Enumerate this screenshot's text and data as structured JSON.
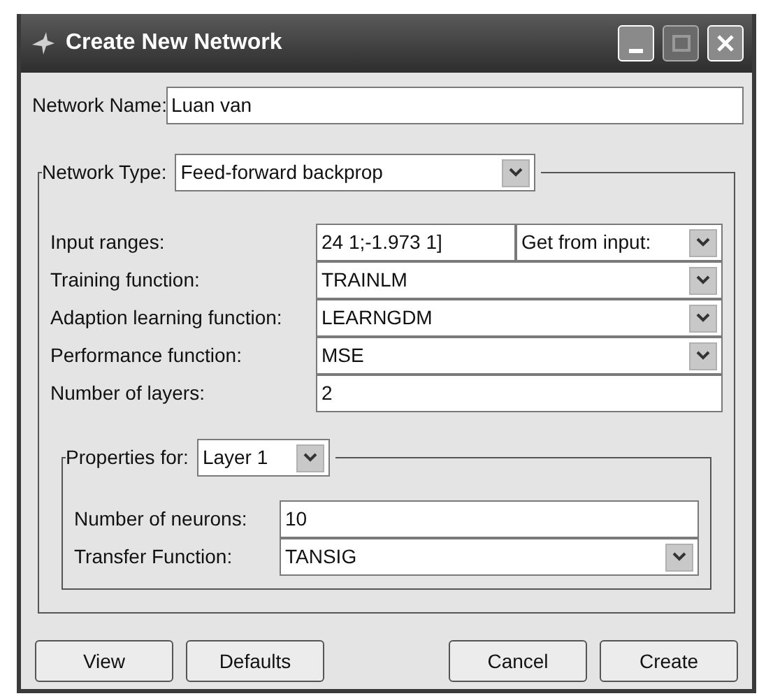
{
  "window": {
    "title": "Create New Network"
  },
  "network_name": {
    "label": "Network Name:",
    "value": "Luan van"
  },
  "network_type": {
    "label": "Network Type:",
    "value": "Feed-forward backprop"
  },
  "fields": [
    {
      "kind": "range",
      "label": "Input ranges:",
      "value": "24 1;-1.973 1]",
      "option": "Get from input:"
    },
    {
      "kind": "combo",
      "label": "Training function:",
      "value": "TRAINLM"
    },
    {
      "kind": "combo",
      "label": "Adaption learning function:",
      "value": "LEARNGDM"
    },
    {
      "kind": "combo",
      "label": "Performance function:",
      "value": "MSE"
    },
    {
      "kind": "text",
      "label": "Number of layers:",
      "value": "2"
    }
  ],
  "properties": {
    "label": "Properties for:",
    "value": "Layer 1",
    "fields": [
      {
        "kind": "text",
        "label": "Number of neurons:",
        "value": "10"
      },
      {
        "kind": "combo",
        "label": "Transfer Function:",
        "value": "TANSIG"
      }
    ]
  },
  "left_buttons": [
    "View",
    "Defaults"
  ],
  "right_buttons": [
    "Cancel",
    "Create"
  ]
}
